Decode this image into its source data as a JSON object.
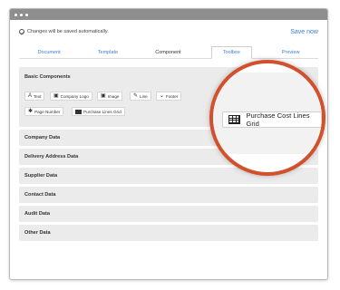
{
  "header": {
    "save_note": "Changes will be saved automatically.",
    "save_now": "Save now"
  },
  "tabs": [
    {
      "label": "Document"
    },
    {
      "label": "Template"
    },
    {
      "label": "Component"
    },
    {
      "label": "Toolbox"
    },
    {
      "label": "Preview"
    }
  ],
  "basic": {
    "title": "Basic Components",
    "items": [
      {
        "label": "Text",
        "icon": "text-icon"
      },
      {
        "label": "Company Logo",
        "icon": "image-icon"
      },
      {
        "label": "Image",
        "icon": "image-icon"
      },
      {
        "label": "Line",
        "icon": "pen-icon"
      },
      {
        "label": "Footer",
        "icon": "chevron-down-icon"
      },
      {
        "label": "Page Number",
        "icon": "gear-icon"
      },
      {
        "label": "Purchase Lines Grid",
        "icon": "grid-icon"
      }
    ]
  },
  "magnified": {
    "label": "Purchase Cost Lines Grid",
    "icon": "grid-icon"
  },
  "sections": [
    {
      "label": "Company Data"
    },
    {
      "label": "Delivery Address Data"
    },
    {
      "label": "Supplier Data"
    },
    {
      "label": "Contact Data"
    },
    {
      "label": "Audit Data"
    },
    {
      "label": "Other Data"
    }
  ]
}
